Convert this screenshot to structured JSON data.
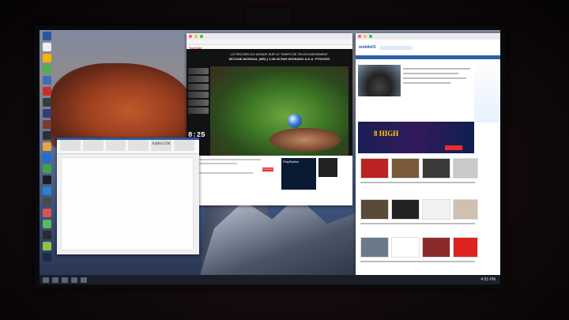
{
  "taskbar": {
    "clock": "4:55 PM"
  },
  "youtube": {
    "logo": "YouTube",
    "video_title": "LE RECORD DU MONDE SUR LE TEMPS DE TELECHARGEMENT",
    "video_subtitle": "SECOND MONDIAL (WR) | 1:08:45 PAR DEDRANO A.K.A. PYSOVEZ",
    "timer": "8:25",
    "subscribe": "Subscribe",
    "ad_title": "PlayStation"
  },
  "news": {
    "logo": "mobile01",
    "banner_text": "8 HIGH"
  },
  "word": {
    "title": "AaBbCcDd"
  }
}
